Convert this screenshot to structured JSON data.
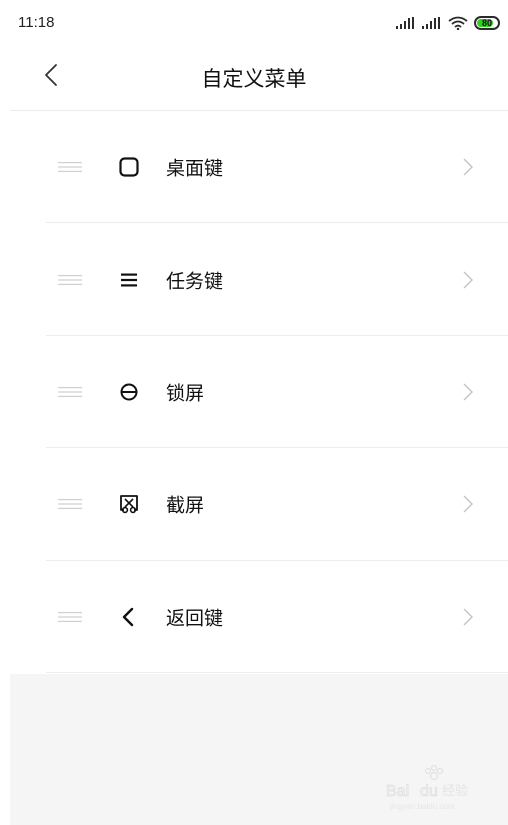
{
  "status_bar": {
    "time": "11:18",
    "battery_level": "80",
    "battery_percent": 80,
    "icons": [
      "signal-icon",
      "signal-icon",
      "wifi-icon",
      "battery-icon"
    ]
  },
  "header": {
    "title": "自定义菜单",
    "back_icon": "chevron-left-icon"
  },
  "menu_items": [
    {
      "label": "桌面键",
      "icon": "square-icon"
    },
    {
      "label": "任务键",
      "icon": "menu-icon"
    },
    {
      "label": "锁屏",
      "icon": "lock-icon"
    },
    {
      "label": "截屏",
      "icon": "screenshot-icon"
    },
    {
      "label": "返回键",
      "icon": "back-icon"
    }
  ],
  "watermark": {
    "brand": "Baidu",
    "text": "经验",
    "subtext": "jingyan.baidu.com"
  },
  "colors": {
    "background": "#ffffff",
    "divider": "#ececec",
    "bottom_area": "#f5f5f5",
    "battery_fill": "#2fd022",
    "text": "#111111",
    "muted": "#c4c4c4"
  }
}
